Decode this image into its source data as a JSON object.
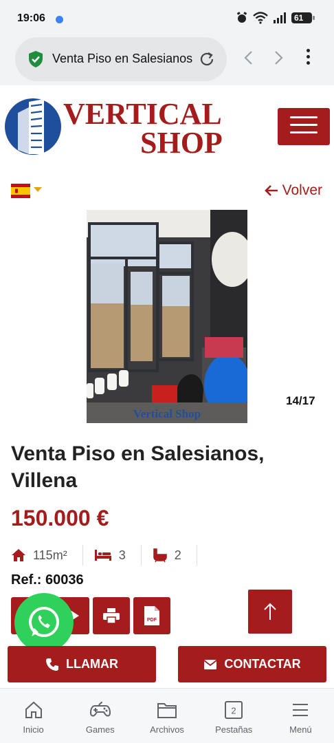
{
  "status": {
    "time": "19:06",
    "battery": "61"
  },
  "browser": {
    "url_title": "Venta Piso en Salesianos, Villena - Vertical Shop",
    "icons": [
      "shield-check-icon",
      "reload-icon",
      "back-arrow-icon",
      "forward-arrow-icon",
      "kebab-menu-icon"
    ]
  },
  "header": {
    "logo_line1": "VERTICAL",
    "logo_line2": "SHOP"
  },
  "nav": {
    "back_label": "Volver",
    "language_flag": "spain-flag-icon"
  },
  "gallery": {
    "counter": "14/17",
    "watermark": "Vertical Shop"
  },
  "listing": {
    "title": "Venta Piso en Salesianos, Villena",
    "price": "150.000 €",
    "area": "115m²",
    "bedrooms": "3",
    "bathrooms": "2",
    "ref": "Ref.: 60036"
  },
  "cta": {
    "call": "LLAMAR",
    "contact": "CONTACTAR"
  },
  "bottom_nav": [
    {
      "label": "Inicio",
      "icon": "home-icon"
    },
    {
      "label": "Games",
      "icon": "gamepad-icon"
    },
    {
      "label": "Archivos",
      "icon": "folder-icon"
    },
    {
      "label": "Pestañas",
      "icon": "tabs-icon",
      "count": "2"
    },
    {
      "label": "Menú",
      "icon": "hamburger-icon"
    }
  ],
  "colors": {
    "brand_red": "#a51c1c",
    "brand_blue": "#1f4f9c",
    "whatsapp_green": "#2fd15a"
  }
}
